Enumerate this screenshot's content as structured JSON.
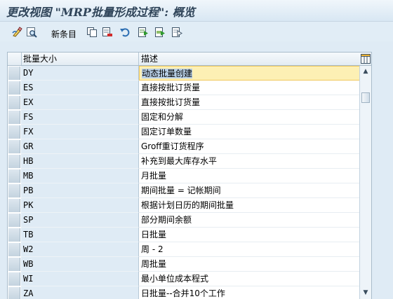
{
  "window": {
    "title": "更改视图 \"MRP批量形成过程\": 概览"
  },
  "toolbar": {
    "new_entries_label": "新条目",
    "icons": [
      "display-change-icon",
      "find-icon",
      "copy-icon",
      "delete-icon",
      "undo-icon",
      "select-all-icon",
      "select-block-icon",
      "deselect-all-icon"
    ]
  },
  "table": {
    "columns": [
      "批量大小",
      "描述"
    ],
    "rows": [
      {
        "code": "DY",
        "desc": "动态批量创建"
      },
      {
        "code": "ES",
        "desc": "直接按批订货量"
      },
      {
        "code": "EX",
        "desc": "直接按批订货量"
      },
      {
        "code": "FS",
        "desc": "固定和分解"
      },
      {
        "code": "FX",
        "desc": "固定订单数量"
      },
      {
        "code": "GR",
        "desc": "Groff重订货程序"
      },
      {
        "code": "HB",
        "desc": "补充到最大库存水平"
      },
      {
        "code": "MB",
        "desc": "月批量"
      },
      {
        "code": "PB",
        "desc": "期间批量 = 记帐期间"
      },
      {
        "code": "PK",
        "desc": "根据计划日历的期间批量"
      },
      {
        "code": "SP",
        "desc": "部分期间余额"
      },
      {
        "code": "TB",
        "desc": "日批量"
      },
      {
        "code": "W2",
        "desc": "周 - 2"
      },
      {
        "code": "WB",
        "desc": "周批量"
      },
      {
        "code": "WI",
        "desc": "最小单位成本程式"
      },
      {
        "code": "ZA",
        "desc": "日批量--合并10个工作"
      }
    ],
    "active_row": 0
  },
  "colors": {
    "background": "#dfebf5",
    "title_text": "#2f4459",
    "active_cell": "#fdf0b4",
    "selection_highlight": "#b9d0e6"
  }
}
